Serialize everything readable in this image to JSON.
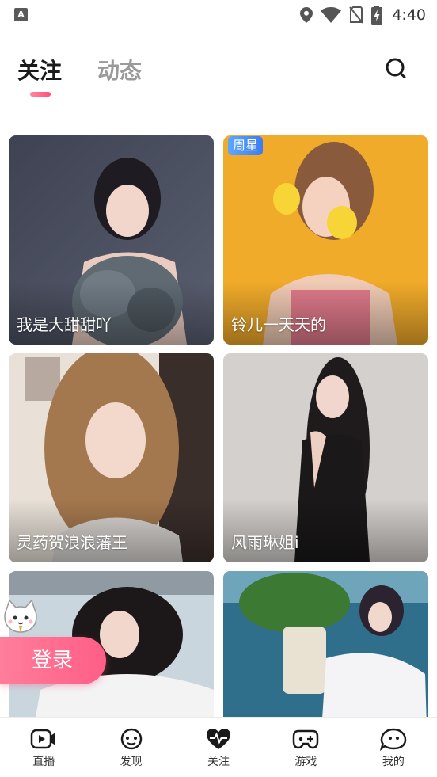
{
  "status_bar": {
    "notification_icon_letter": "A",
    "time": "4:40",
    "icons": [
      "location-icon",
      "wifi-icon",
      "no-sim-icon",
      "battery-charging-icon"
    ]
  },
  "header": {
    "tabs": [
      {
        "label": "关注",
        "active": true
      },
      {
        "label": "动态",
        "active": false
      }
    ],
    "accent_color": "#ff5e86"
  },
  "grid": {
    "cards": [
      {
        "name": "我是大甜甜吖",
        "badge": "",
        "photo": "woman-grey-feather-dress"
      },
      {
        "name": "铃儿一天天的",
        "badge": "周星",
        "photo": "woman-with-lemons-yellow-background"
      },
      {
        "name": "灵药贺浪浪藩王",
        "badge": "",
        "photo": "woman-long-hair-selfie-room"
      },
      {
        "name": "风雨琳姐i",
        "badge": "",
        "photo": "woman-black-dress-grey-background"
      },
      {
        "name": "",
        "badge": "",
        "photo": "woman-white-shirt-bed"
      },
      {
        "name": "",
        "badge": "",
        "photo": "woman-white-dress-plant"
      }
    ]
  },
  "login_float": {
    "label": "登录",
    "mascot": "cat-mascot-icon"
  },
  "bottom_nav": {
    "items": [
      {
        "label": "直播",
        "icon": "video-camera-icon"
      },
      {
        "label": "发现",
        "icon": "discover-face-icon"
      },
      {
        "label": "关注",
        "icon": "heart-pulse-icon",
        "active": true
      },
      {
        "label": "游戏",
        "icon": "gamepad-icon"
      },
      {
        "label": "我的",
        "icon": "profile-bubble-icon"
      }
    ]
  }
}
